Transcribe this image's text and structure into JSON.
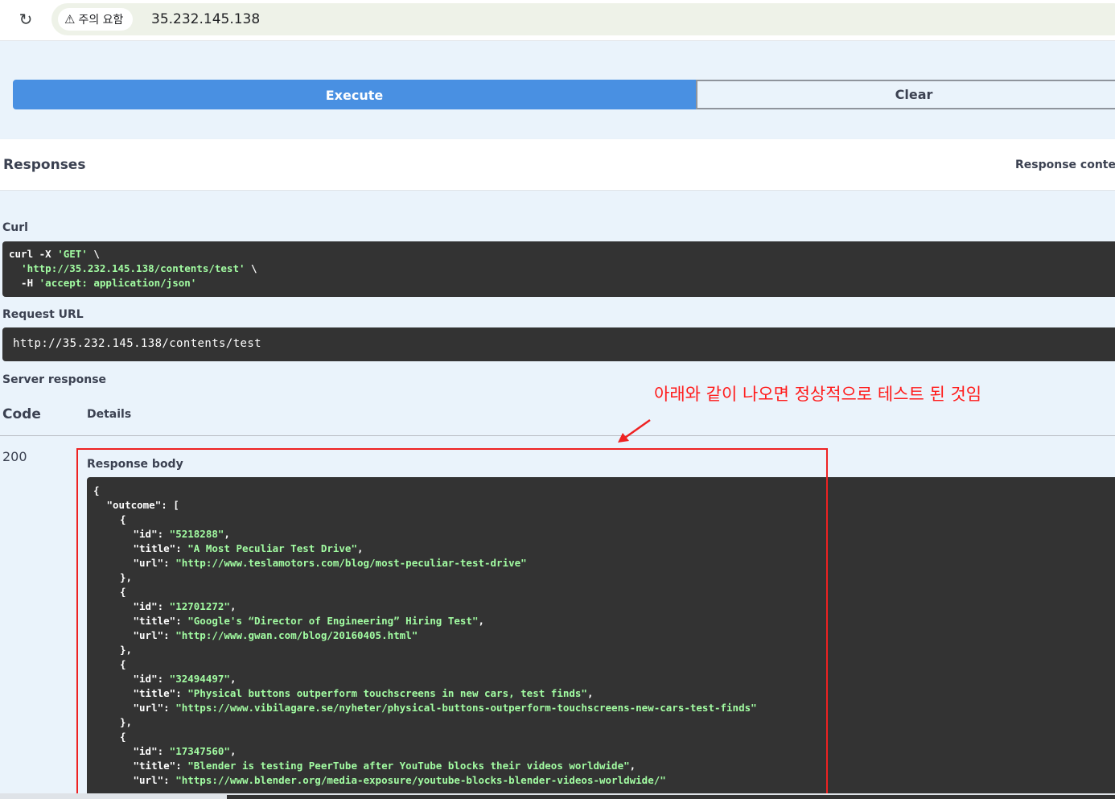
{
  "browser": {
    "warning_label": "주의 요함",
    "address": "35.232.145.138"
  },
  "buttons": {
    "execute": "Execute",
    "clear": "Clear"
  },
  "responses": {
    "title": "Responses",
    "content_type_label": "Response content"
  },
  "curl": {
    "label": "Curl",
    "lines": [
      {
        "cmd": "curl -X ",
        "str": "'GET'",
        "tail": " \\"
      },
      {
        "cmd": "  ",
        "str": "'http://35.232.145.138/contents/test'",
        "tail": " \\"
      },
      {
        "cmd": "  -H ",
        "str": "'accept: application/json'",
        "tail": ""
      }
    ]
  },
  "request_url": {
    "label": "Request URL",
    "value": "http://35.232.145.138/contents/test"
  },
  "server_response": {
    "label": "Server response",
    "col_code": "Code",
    "col_details": "Details",
    "code": "200",
    "body_label": "Response body"
  },
  "response_body_lines": [
    {
      "indent": 0,
      "key": "",
      "val": "",
      "tail": "{"
    },
    {
      "indent": 1,
      "key": "\"outcome\"",
      "val": "",
      "tail": ": ["
    },
    {
      "indent": 2,
      "key": "",
      "val": "",
      "tail": "{"
    },
    {
      "indent": 3,
      "key": "\"id\"",
      "val": "\"5218288\"",
      "tail": ","
    },
    {
      "indent": 3,
      "key": "\"title\"",
      "val": "\"A Most Peculiar Test Drive\"",
      "tail": ","
    },
    {
      "indent": 3,
      "key": "\"url\"",
      "val": "\"http://www.teslamotors.com/blog/most-peculiar-test-drive\"",
      "tail": ""
    },
    {
      "indent": 2,
      "key": "",
      "val": "",
      "tail": "},"
    },
    {
      "indent": 2,
      "key": "",
      "val": "",
      "tail": "{"
    },
    {
      "indent": 3,
      "key": "\"id\"",
      "val": "\"12701272\"",
      "tail": ","
    },
    {
      "indent": 3,
      "key": "\"title\"",
      "val": "\"Google's “Director of Engineering” Hiring Test\"",
      "tail": ","
    },
    {
      "indent": 3,
      "key": "\"url\"",
      "val": "\"http://www.gwan.com/blog/20160405.html\"",
      "tail": ""
    },
    {
      "indent": 2,
      "key": "",
      "val": "",
      "tail": "},"
    },
    {
      "indent": 2,
      "key": "",
      "val": "",
      "tail": "{"
    },
    {
      "indent": 3,
      "key": "\"id\"",
      "val": "\"32494497\"",
      "tail": ","
    },
    {
      "indent": 3,
      "key": "\"title\"",
      "val": "\"Physical buttons outperform touchscreens in new cars, test finds\"",
      "tail": ","
    },
    {
      "indent": 3,
      "key": "\"url\"",
      "val": "\"https://www.vibilagare.se/nyheter/physical-buttons-outperform-touchscreens-new-cars-test-finds\"",
      "tail": ""
    },
    {
      "indent": 2,
      "key": "",
      "val": "",
      "tail": "},"
    },
    {
      "indent": 2,
      "key": "",
      "val": "",
      "tail": "{"
    },
    {
      "indent": 3,
      "key": "\"id\"",
      "val": "\"17347560\"",
      "tail": ","
    },
    {
      "indent": 3,
      "key": "\"title\"",
      "val": "\"Blender is testing PeerTube after YouTube blocks their videos worldwide\"",
      "tail": ","
    },
    {
      "indent": 3,
      "key": "\"url\"",
      "val": "\"https://www.blender.org/media-exposure/youtube-blocks-blender-videos-worldwide/\"",
      "tail": ""
    }
  ],
  "annotation": {
    "text": "아래와 같이 나오면 정상적으로 테스트 된 것임",
    "color": "#ff1a1a"
  },
  "colors": {
    "execute_blue": "#4990e2",
    "code_bg": "#333333",
    "string_green": "#a2fca2",
    "page_bg": "#eaf3fb"
  },
  "icons": {
    "reload": "reload-icon",
    "warning": "warning-icon"
  }
}
